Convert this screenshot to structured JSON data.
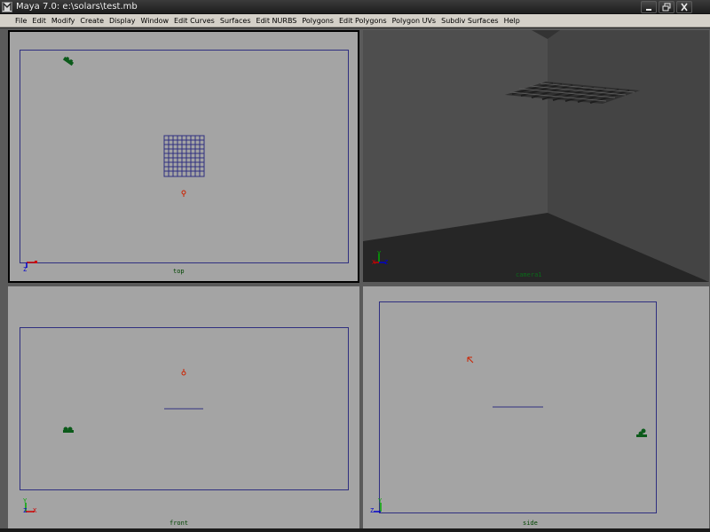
{
  "window": {
    "title": "Maya 7.0: e:\\solars\\test.mb",
    "icon": "maya-app-icon",
    "controls": [
      "minimize-icon",
      "maximize-icon",
      "close-icon"
    ]
  },
  "menu": {
    "items": [
      {
        "label": "File"
      },
      {
        "label": "Edit"
      },
      {
        "label": "Modify"
      },
      {
        "label": "Create"
      },
      {
        "label": "Display"
      },
      {
        "label": "Window"
      },
      {
        "label": "Edit Curves"
      },
      {
        "label": "Surfaces"
      },
      {
        "label": "Edit NURBS"
      },
      {
        "label": "Polygons"
      },
      {
        "label": "Edit Polygons"
      },
      {
        "label": "Polygon UVs"
      },
      {
        "label": "Subdiv Surfaces"
      },
      {
        "label": "Help"
      }
    ]
  },
  "viewports": {
    "top": {
      "camera_label": "top",
      "axis_labels": {
        "x": "X",
        "z": "Z"
      }
    },
    "persp": {
      "camera_label": "camera1",
      "axis_labels": {
        "x": "X",
        "y": "Y",
        "z": "Z"
      }
    },
    "front": {
      "camera_label": "front",
      "axis_labels": {
        "x": "X",
        "y": "Y",
        "z": "Z"
      }
    },
    "side": {
      "camera_label": "side",
      "axis_labels": {
        "y": "Y",
        "z": "Z"
      }
    }
  },
  "colors": {
    "viewport_bg": "#a4a4a4",
    "gate_line": "#2f2f80",
    "label_green": "#004400",
    "axis_red": "#cc0000",
    "axis_green": "#00aa00",
    "axis_blue": "#0000cc",
    "light_red": "#cc2200"
  }
}
